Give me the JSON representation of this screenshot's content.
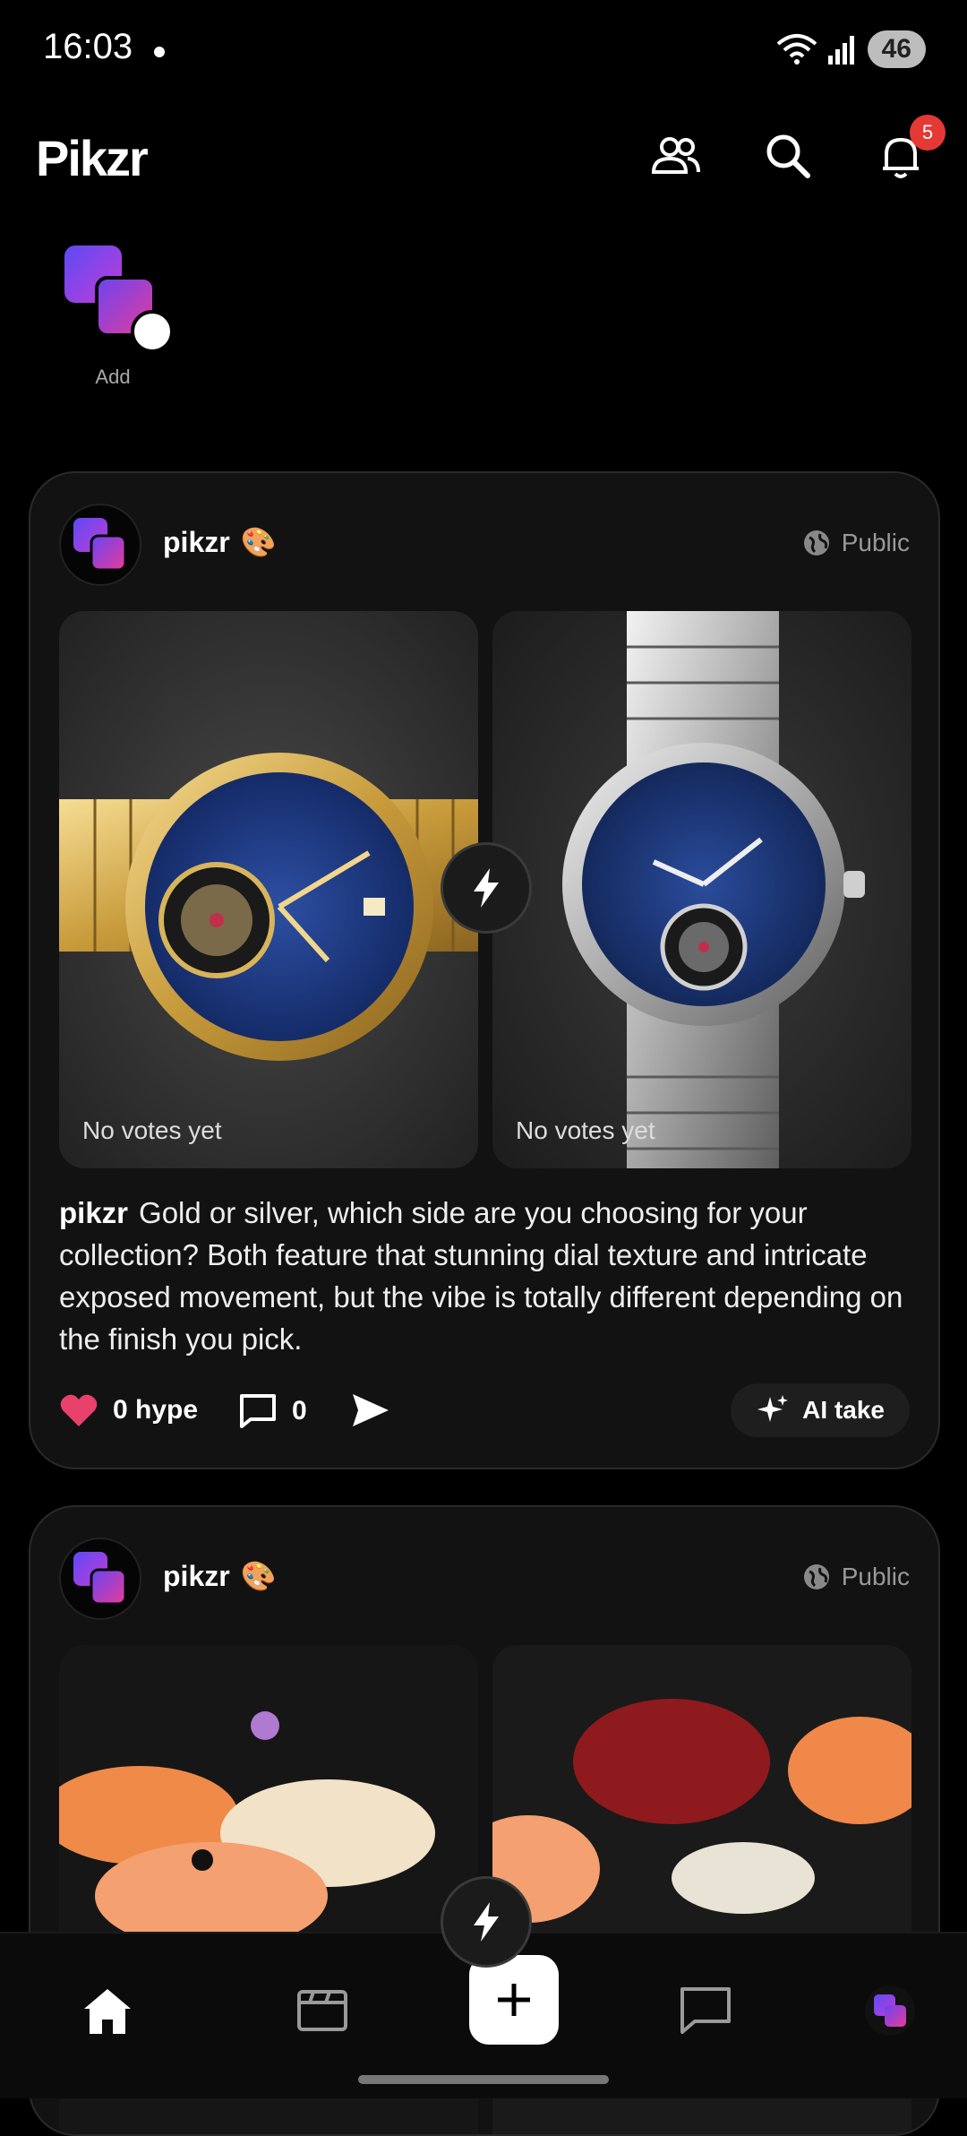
{
  "status": {
    "time": "16:03",
    "battery": "46"
  },
  "app": {
    "title": "Pikzr",
    "notification_count": "5"
  },
  "stories": {
    "add_label": "Add"
  },
  "posts": [
    {
      "username": "pikzr",
      "emoji": "🎨",
      "visibility": "Public",
      "left_votes": "No votes yet",
      "right_votes": "No votes yet",
      "caption_user": "pikzr",
      "caption": "Gold or silver, which side are you choosing for your collection? Both feature that stunning dial texture and intricate exposed movement, but the vibe is totally different depending on the finish you pick.",
      "hype": "0 hype",
      "comments": "0",
      "ai_label": "AI take"
    },
    {
      "username": "pikzr",
      "emoji": "🎨",
      "visibility": "Public"
    }
  ],
  "colors": {
    "accent_purple": "#7b3cf0",
    "accent_pink": "#e63c9a",
    "heart": "#e8416b",
    "badge": "#e53935"
  }
}
